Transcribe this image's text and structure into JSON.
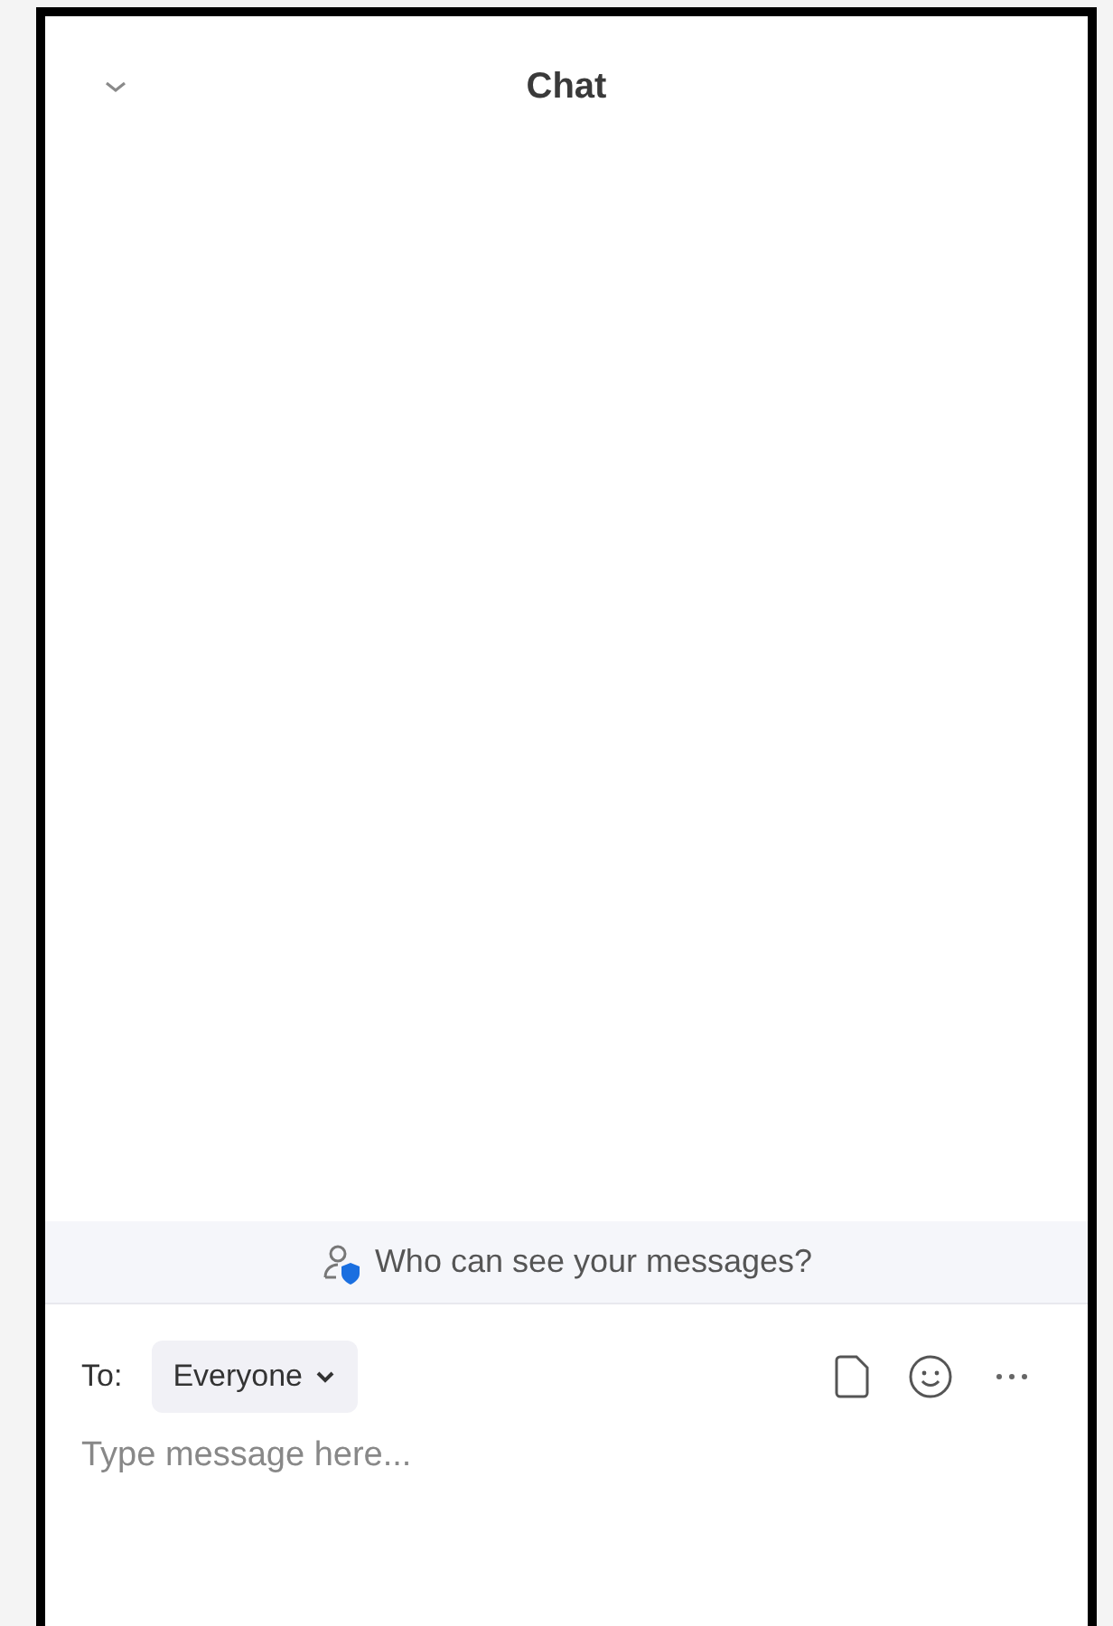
{
  "header": {
    "title": "Chat"
  },
  "notice": {
    "text": "Who can see your messages?"
  },
  "recipient": {
    "label": "To:",
    "value": "Everyone"
  },
  "composer": {
    "placeholder": "Type message here..."
  }
}
